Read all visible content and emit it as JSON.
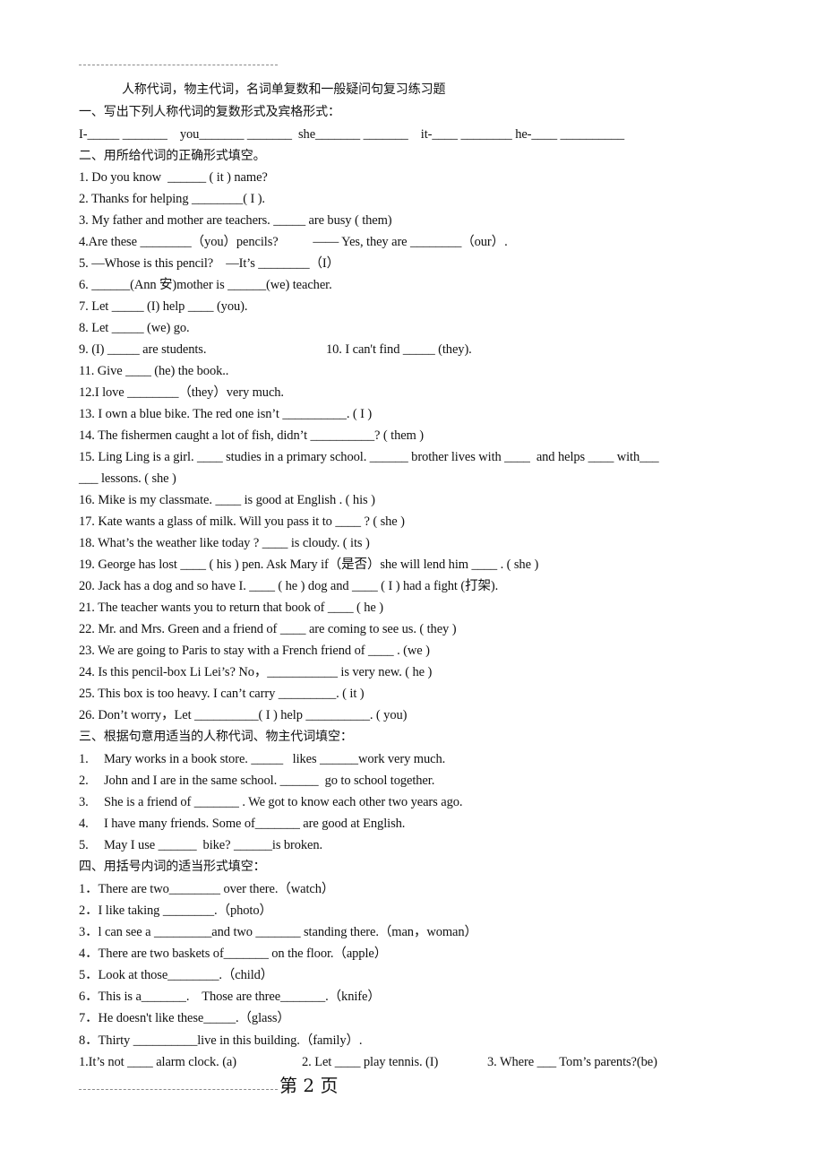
{
  "document": {
    "title": "人称代词，物主代词，名词单复数和一般疑问句复习练习题",
    "sections": [
      {
        "heading": "一、写出下列人称代词的复数形式及宾格形式：",
        "lines": [
          "I-_____ _______    you_______ _______  she_______ _______    it-____ ________ he-____ __________"
        ]
      },
      {
        "heading": "二、用所给代词的正确形式填空。",
        "lines": [
          "1. Do you know  ______ ( it ) name?",
          "2. Thanks for helping ________( I ).",
          "3. My father and mother are teachers. _____ are busy ( them)",
          "4.Are these ________（you）pencils?           —— Yes, they are ________（our）.",
          "5. —Whose is this pencil?    —It’s ________（I）",
          "6. ______(Ann 安)mother is ______(we) teacher.",
          "7. Let _____ (I) help ____ (you).",
          "8. Let _____ (we) go.",
          "9. (I) _____ are students.",
          "10. I can't find _____ (they).",
          "11. Give ____ (he) the book..",
          "12.I love ________（they）very much.",
          "13. I own a blue bike. The red one isn’t __________. ( I )",
          "14. The fishermen caught a lot of fish, didn’t __________? ( them )",
          "15. Ling Ling is a girl. ____ studies in a primary school. ______ brother lives with ____  and helps ____ with___",
          "___ lessons. ( she )",
          "16. Mike is my classmate. ____ is good at English . ( his )",
          "17. Kate wants a glass of milk. Will you pass it to ____ ? ( she )",
          "18. What’s the weather like today ? ____ is cloudy. ( its )",
          "19. George has lost ____ ( his ) pen. Ask Mary if（是否）she will lend him ____ . ( she )",
          "20. Jack has a dog and so have I. ____ ( he ) dog and ____ ( I ) had a fight (打架).",
          "21. The teacher wants you to return that book of ____ ( he )",
          "22. Mr. and Mrs. Green and a friend of ____ are coming to see us. ( they )",
          "23. We are going to Paris to stay with a French friend of ____ . (we )",
          "24. Is this pencil-box Li Lei’s? No，___________ is very new. ( he )",
          "25. This box is too heavy. I can’t carry _________. ( it )",
          "26. Don’t worry，Let __________( I ) help __________. ( you)"
        ]
      },
      {
        "heading": "三、根据句意用适当的人称代词、物主代词填空：",
        "items": [
          {
            "num": "1.",
            "text": "Mary works in a book store. _____   likes ______work very much."
          },
          {
            "num": "2.",
            "text": "John and I are in the same school. ______  go to school together."
          },
          {
            "num": "3.",
            "text": "She is a friend of _______ . We got to know each other two years ago."
          },
          {
            "num": "4.",
            "text": "I have many friends. Some of_______ are good at English."
          },
          {
            "num": "5.",
            "text": "May I use ______  bike? ______is broken."
          }
        ]
      },
      {
        "heading": "四、用括号内词的适当形式填空：",
        "lines": [
          "1．There are two________ over there.（watch）",
          "2．I like taking ________.（photo）",
          "3．l can see a _________and two _______ standing there.（man，woman）",
          "4．There are two baskets of_______ on the floor.（apple）",
          "5．Look at those________.（child）",
          "6．This is a_______.    Those are three_______.（knife）",
          "7．He doesn't like these_____.（glass）",
          "8．Thirty __________live in this building.（family）."
        ]
      }
    ],
    "last_line": {
      "a": "1.It’s not ____ alarm clock. (a)",
      "b": "2. Let ____ play tennis. (I)",
      "c": "3. Where ___ Tom’s parents?(be)"
    },
    "footer": "第 2 页"
  }
}
